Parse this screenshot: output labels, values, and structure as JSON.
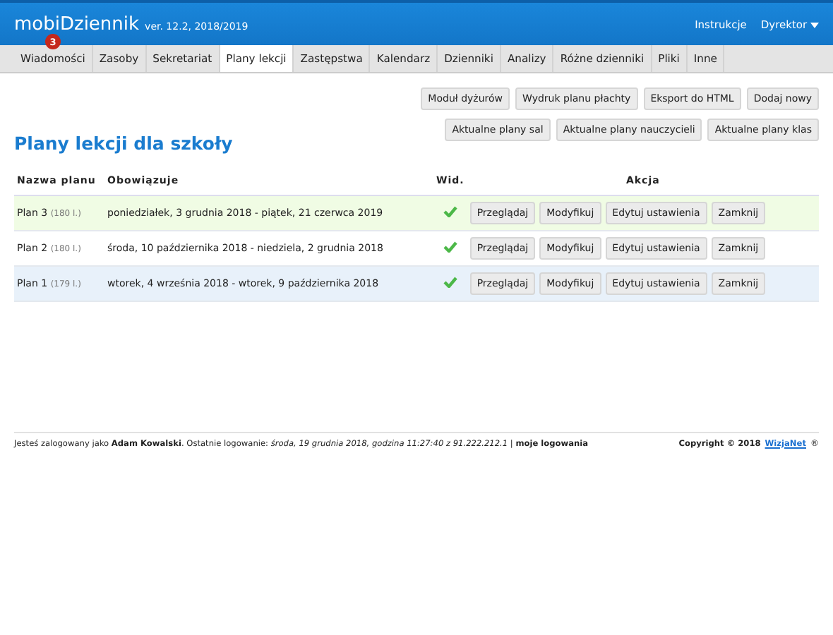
{
  "header": {
    "logo": "mobiDziennik",
    "version": "ver. 12.2, 2018/2019",
    "links": [
      "Instrukcje"
    ],
    "user_menu": "Dyrektor"
  },
  "nav": {
    "tabs": [
      {
        "label": "Wiadomości",
        "selected": false,
        "badge": "3"
      },
      {
        "label": "Zasoby",
        "selected": false
      },
      {
        "label": "Sekretariat",
        "selected": false
      },
      {
        "label": "Plany lekcji",
        "selected": true
      },
      {
        "label": "Zastępstwa",
        "selected": false
      },
      {
        "label": "Kalendarz",
        "selected": false
      },
      {
        "label": "Dzienniki",
        "selected": false
      },
      {
        "label": "Analizy",
        "selected": false
      },
      {
        "label": "Różne dzienniki",
        "selected": false
      },
      {
        "label": "Pliki",
        "selected": false
      },
      {
        "label": "Inne",
        "selected": false
      }
    ]
  },
  "toolbar_rows": [
    [
      "Moduł dyżurów",
      "Wydruk planu płachty",
      "Eksport do HTML",
      "Dodaj nowy"
    ],
    [
      "Aktualne plany sal",
      "Aktualne plany nauczycieli",
      "Aktualne plany klas"
    ]
  ],
  "page_title": "Plany lekcji dla szkoły",
  "table": {
    "columns": [
      "Nazwa planu",
      "Obowiązuje",
      "Wid.",
      "Akcja"
    ],
    "rows": [
      {
        "name": "Plan 3",
        "count": "(180 l.)",
        "period": "poniedziałek, 3 grudnia 2018 - piątek, 21 czerwca 2019",
        "visible": true,
        "color": "#f0fce4",
        "actions": [
          "Przeglądaj",
          "Modyfikuj",
          "Edytuj ustawienia",
          "Zamknij"
        ]
      },
      {
        "name": "Plan 2",
        "count": "(180 l.)",
        "period": "środa, 10 października 2018 - niedziela, 2 grudnia 2018",
        "visible": true,
        "color": "#ffffff",
        "actions": [
          "Przeglądaj",
          "Modyfikuj",
          "Edytuj ustawienia",
          "Zamknij"
        ]
      },
      {
        "name": "Plan 1",
        "count": "(179 l.)",
        "period": "wtorek, 4 września 2018 - wtorek, 9 października 2018",
        "visible": true,
        "color": "#e8f1fa",
        "actions": [
          "Przeglądaj",
          "Modyfikuj",
          "Edytuj ustawienia",
          "Zamknij"
        ]
      }
    ]
  },
  "footer": {
    "session": "Jesteś zalogowany jako **Adam Kowalski**. Ostatnie logowanie: *środa, 19 grudnia 2018, godzina 11:27:40 z 91.222.212.1* | **moje logowania**",
    "copyright": "Copyright © 2018",
    "company_link": "WizjaNet",
    "mark": "®"
  }
}
